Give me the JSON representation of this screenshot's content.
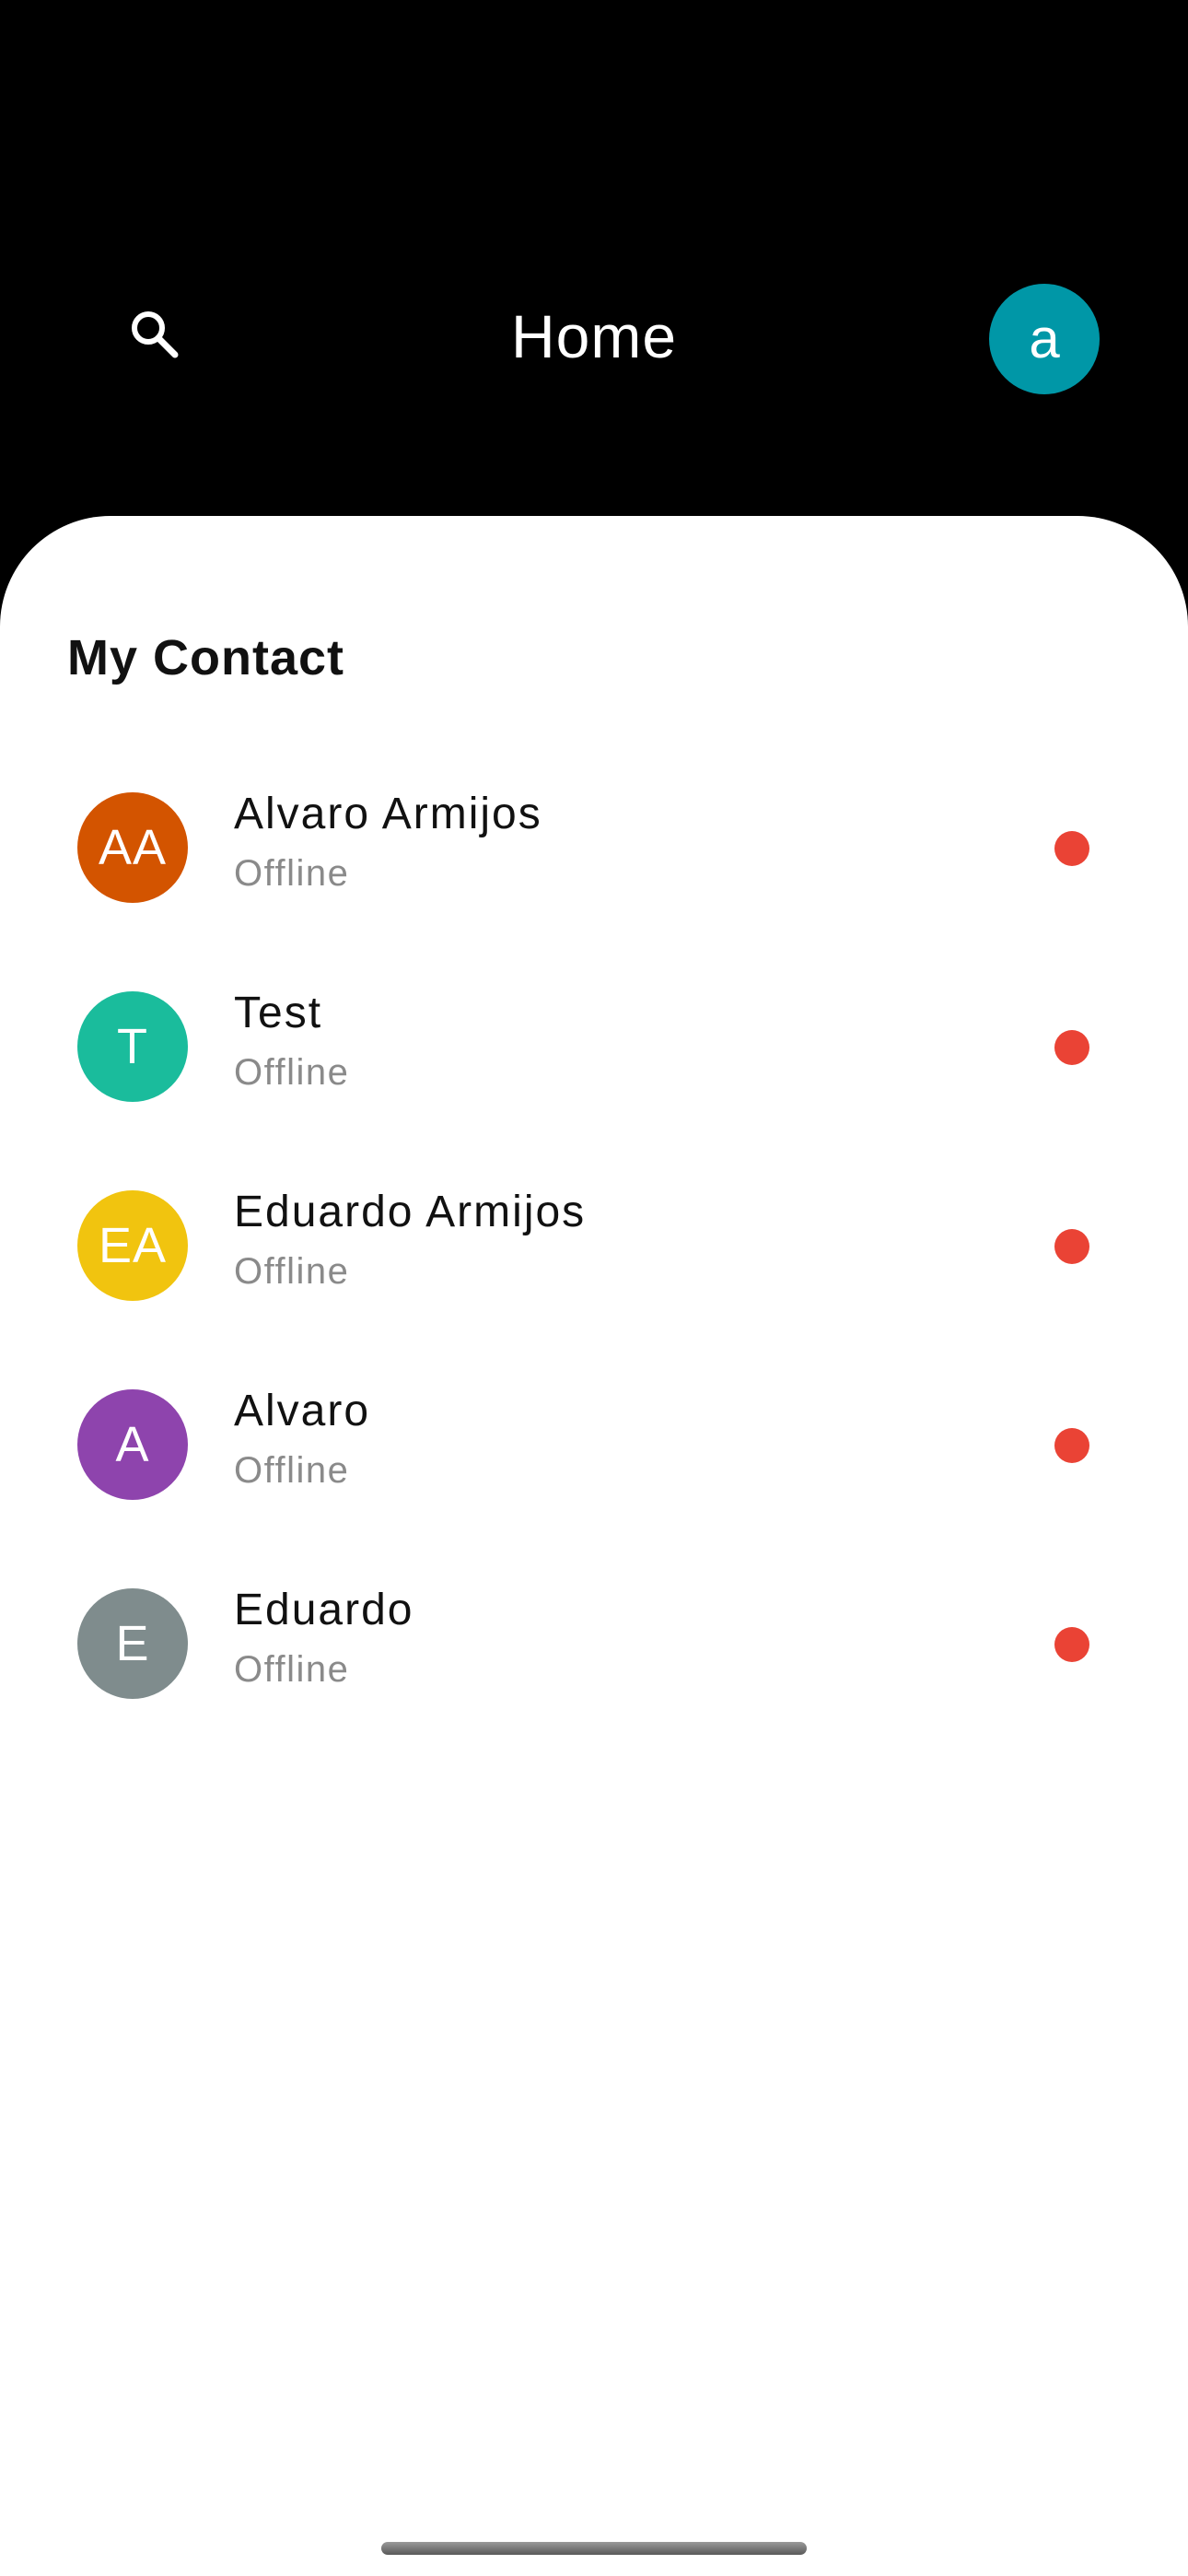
{
  "header": {
    "title": "Home",
    "search_icon": "search-icon",
    "profile_initial": "a"
  },
  "section": {
    "title": "My Contact"
  },
  "contacts": [
    {
      "initials": "AA",
      "name": "Alvaro Armijos",
      "status": "Offline",
      "avatar_color": "#d35400"
    },
    {
      "initials": "T",
      "name": "Test",
      "status": "Offline",
      "avatar_color": "#1abc9c"
    },
    {
      "initials": "EA",
      "name": "Eduardo Armijos",
      "status": "Offline",
      "avatar_color": "#f1c40f"
    },
    {
      "initials": "A",
      "name": "Alvaro",
      "status": "Offline",
      "avatar_color": "#8e44ad"
    },
    {
      "initials": "E",
      "name": "Eduardo",
      "status": "Offline",
      "avatar_color": "#7f8c8d"
    }
  ],
  "colors": {
    "header_bg": "#000000",
    "sheet_bg": "#ffffff",
    "profile_avatar": "#0097a7",
    "offline_dot": "#ea4335",
    "status_text": "#8a8a8a"
  }
}
